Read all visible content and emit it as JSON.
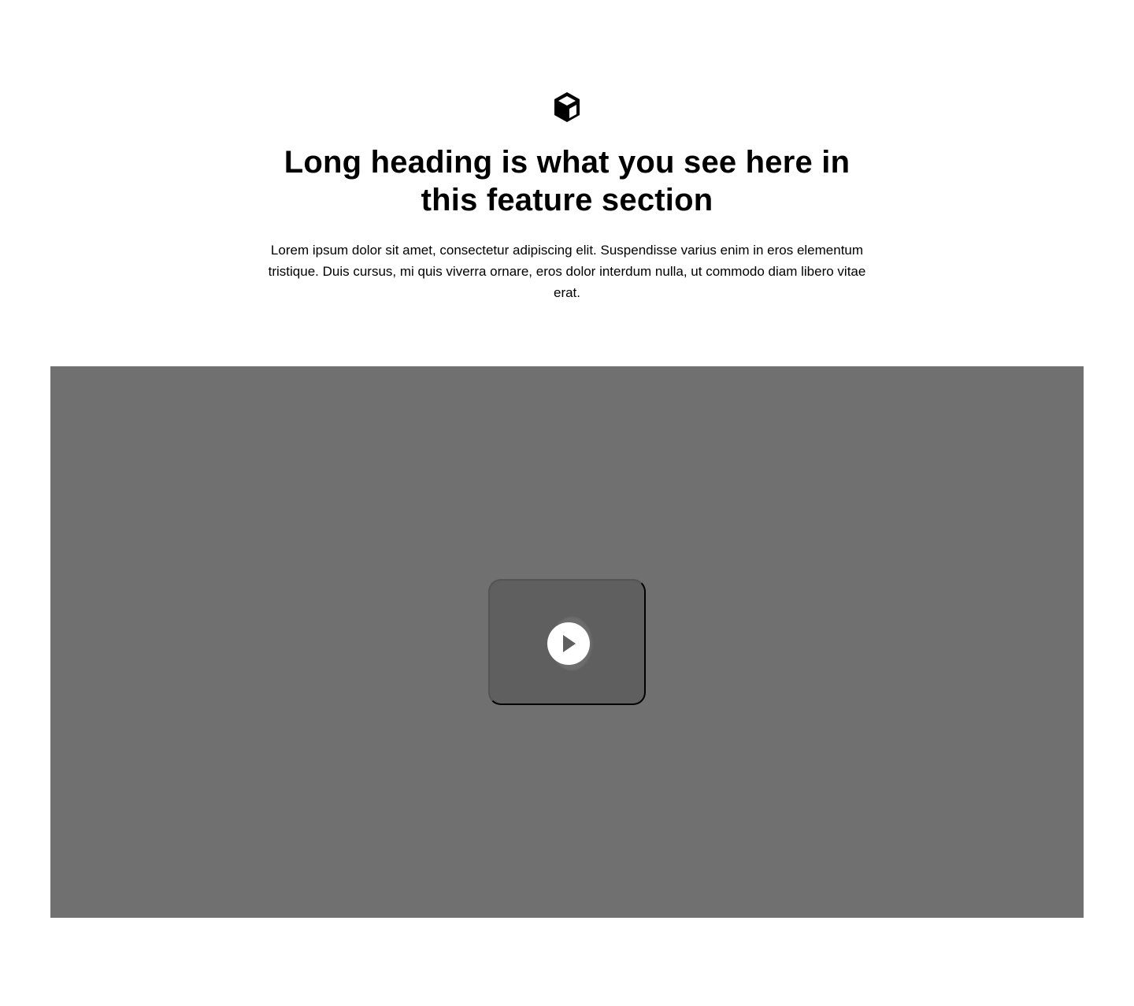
{
  "feature": {
    "icon": "cube-icon",
    "heading": "Long heading is what you see here in this feature section",
    "description": "Lorem ipsum dolor sit amet, consectetur adipiscing elit. Suspendisse varius enim in eros elementum tristique. Duis cursus, mi quis viverra ornare, eros dolor interdum nulla, ut commodo diam libero vitae erat."
  },
  "media": {
    "type": "video-placeholder",
    "play_icon": "play-icon",
    "background_color": "#707070",
    "card_color": "#5f5f5f"
  }
}
